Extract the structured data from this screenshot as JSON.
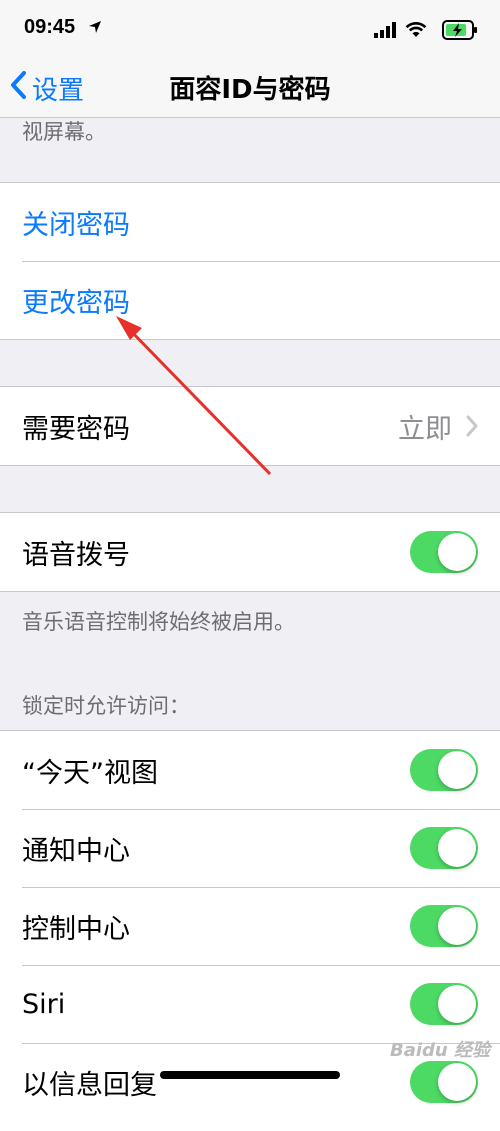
{
  "status_bar": {
    "time": "09:45"
  },
  "nav": {
    "back_label": "设置",
    "title": "面容ID与密码"
  },
  "clipped_note": "视屏幕。",
  "passcode_group": {
    "turn_off": "关闭密码",
    "change": "更改密码"
  },
  "require_group": {
    "label": "需要密码",
    "value": "立即"
  },
  "voice_dial": {
    "label": "语音拨号",
    "enabled": true
  },
  "voice_footer": "音乐语音控制将始终被启用。",
  "lock_access": {
    "header": "锁定时允许访问：",
    "items": [
      {
        "label": "“今天”视图",
        "enabled": true
      },
      {
        "label": "通知中心",
        "enabled": true
      },
      {
        "label": "控制中心",
        "enabled": true
      },
      {
        "label": "Siri",
        "enabled": true
      },
      {
        "label": "以信息回复",
        "enabled": true
      }
    ]
  },
  "watermark": "Baidu 经验",
  "colors": {
    "accent": "#0a7aff",
    "toggle_on": "#4cd964",
    "annotation": "#e8302a"
  }
}
